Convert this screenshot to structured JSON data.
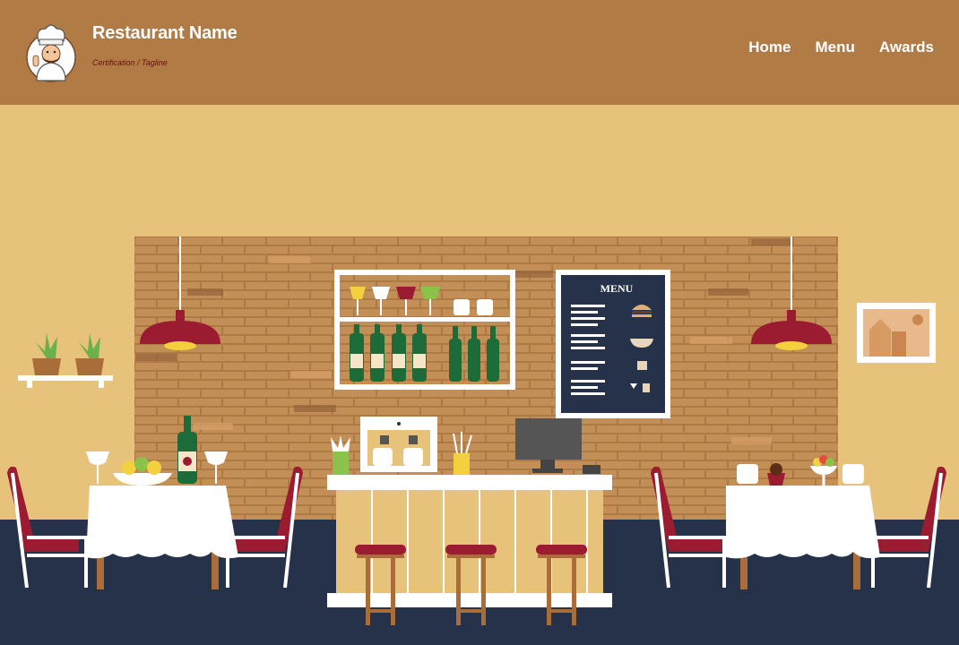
{
  "site": {
    "title": "Restaurant Name",
    "tagline": "Certification / Tagline"
  },
  "nav": {
    "items": [
      {
        "label": "Home"
      },
      {
        "label": "Menu"
      },
      {
        "label": "Awards"
      }
    ]
  },
  "hero": {
    "chalkboard_title": "MENU"
  },
  "colors": {
    "header_bg": "#b17b45",
    "wall": "#e7c27b",
    "floor": "#253249",
    "brick": "#b07d4a",
    "accent_red": "#9b1b30"
  }
}
